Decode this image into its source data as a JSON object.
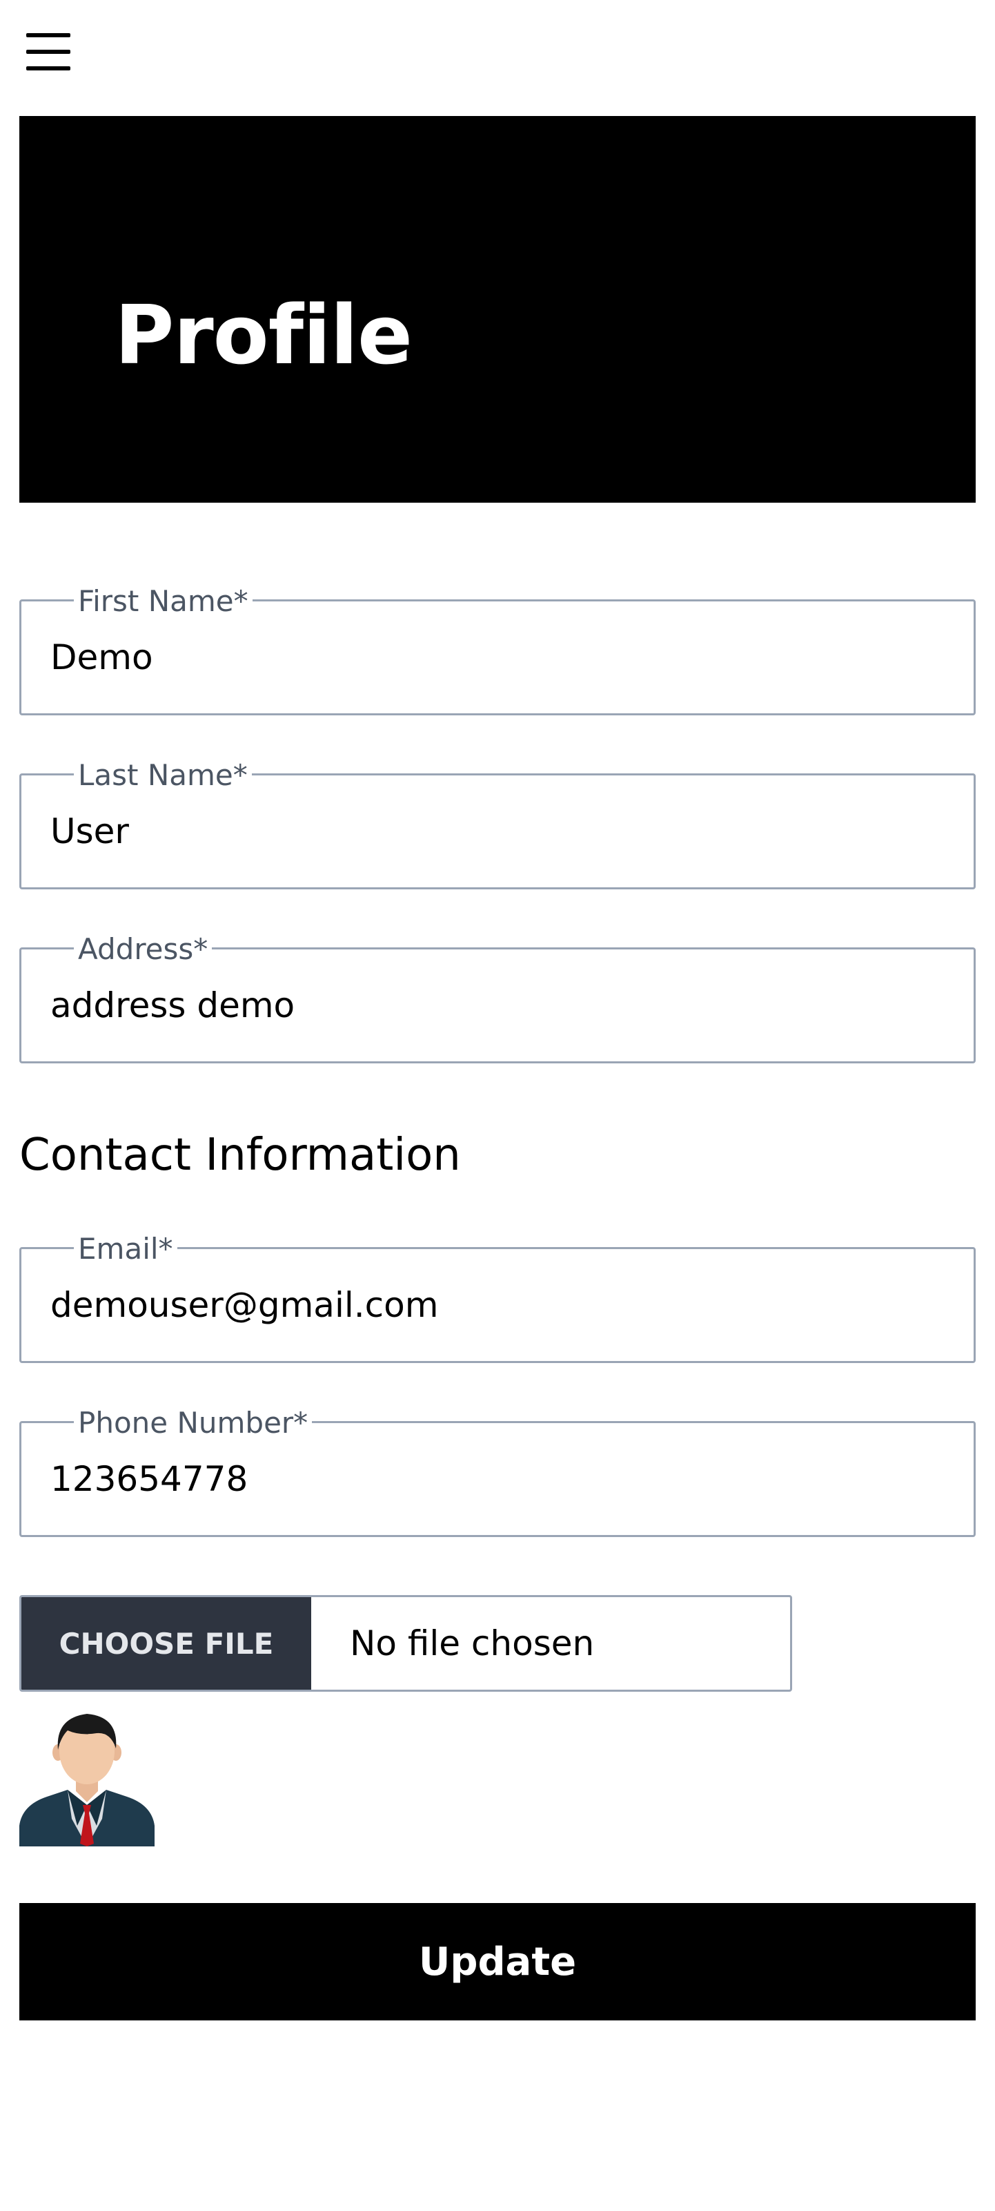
{
  "header": {
    "menu_icon": "hamburger-menu-icon"
  },
  "hero": {
    "title": "Profile"
  },
  "form": {
    "first_name": {
      "label": "First Name*",
      "value": "Demo"
    },
    "last_name": {
      "label": "Last Name*",
      "value": "User"
    },
    "address": {
      "label": "Address*",
      "value": "address demo"
    },
    "contact_heading": "Contact Information",
    "email": {
      "label": "Email*",
      "value": "demouser@gmail.com"
    },
    "phone": {
      "label": "Phone Number*",
      "value": "123654778"
    },
    "file": {
      "button_label": "CHOOSE FILE",
      "status": "No file chosen"
    },
    "avatar_icon": "user-avatar-icon",
    "submit_label": "Update"
  },
  "colors": {
    "hero_bg": "#000000",
    "field_border": "#9aa5b5",
    "label_text": "#4b5563",
    "file_button_bg": "#2e3440",
    "submit_bg": "#000000"
  }
}
